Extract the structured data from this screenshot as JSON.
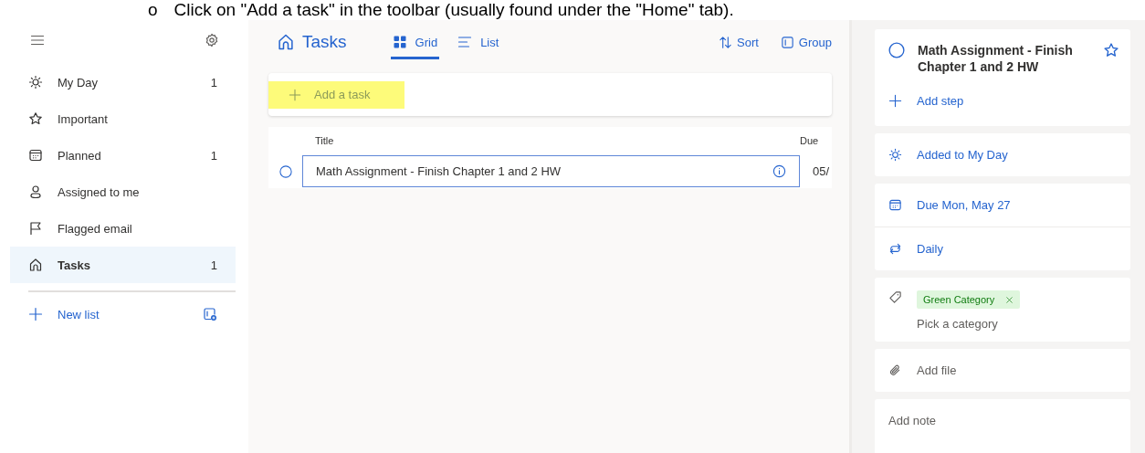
{
  "doc_line": {
    "bullet": "o",
    "text": "Click on \"Add a task\" in the toolbar (usually found under the \"Home\" tab)."
  },
  "sidebar": {
    "items": [
      {
        "label": "My Day",
        "count": "1",
        "selected": false
      },
      {
        "label": "Important",
        "selected": false
      },
      {
        "label": "Planned",
        "count": "1",
        "selected": false
      },
      {
        "label": "Assigned to me",
        "selected": false
      },
      {
        "label": "Flagged email",
        "selected": false
      },
      {
        "label": "Tasks",
        "count": "1",
        "selected": true
      }
    ],
    "new_list": "New list"
  },
  "main": {
    "title": "Tasks",
    "views": [
      {
        "label": "Grid",
        "selected": true
      },
      {
        "label": "List",
        "selected": false
      }
    ],
    "actions": [
      {
        "label": "Sort"
      },
      {
        "label": "Group"
      }
    ],
    "add_task": {
      "placeholder": "Add a task",
      "highlighted": true
    },
    "table": {
      "columns": [
        "Title",
        "Due"
      ],
      "rows": [
        {
          "title": "Math Assignment - Finish Chapter 1 and 2 HW",
          "due": "05/",
          "completed": false
        }
      ]
    }
  },
  "detail": {
    "title": "Math Assignment - Finish Chapter 1 and 2 HW",
    "completed": false,
    "important": false,
    "add_step": "Add step",
    "my_day": "Added to My Day",
    "due": "Due Mon, May 27",
    "repeat": "Daily",
    "categories": [
      {
        "label": "Green Category"
      }
    ],
    "pick_category": "Pick a category",
    "add_file": "Add file",
    "note": {
      "placeholder": "Add note"
    }
  }
}
